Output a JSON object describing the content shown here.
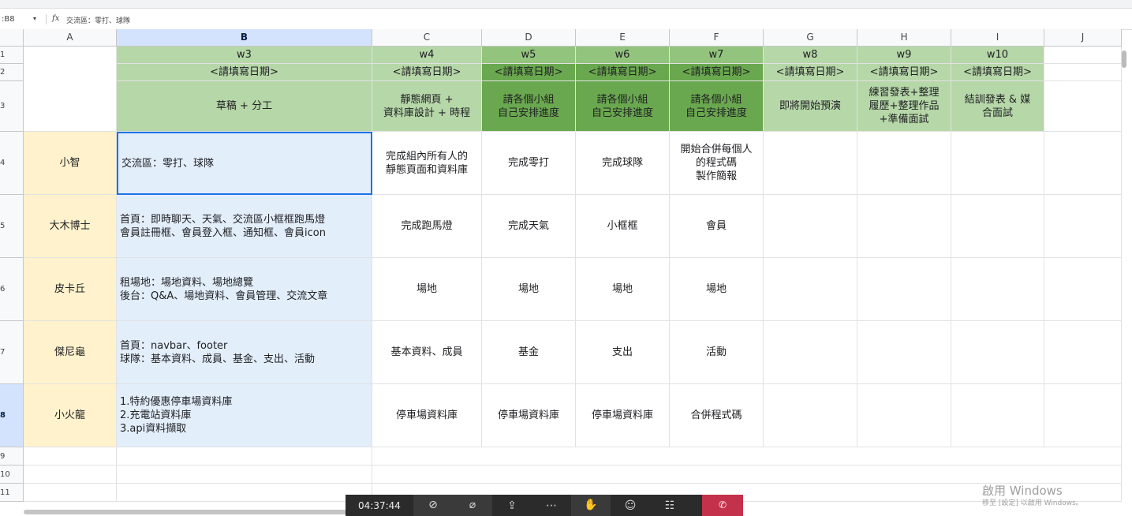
{
  "formula_bar": {
    "cell_ref": ":B8",
    "dropdown": "▾",
    "fx": "fx",
    "content": "交流區：零打、球隊"
  },
  "columns": [
    "A",
    "B",
    "C",
    "D",
    "E",
    "F",
    "G",
    "H",
    "I",
    "J"
  ],
  "rows": [
    "1",
    "2",
    "3",
    "4",
    "5",
    "6",
    "7",
    "8",
    "9",
    "10",
    "11"
  ],
  "sheet": {
    "weeks": [
      "w3",
      "w4",
      "w5",
      "w6",
      "w7",
      "w8",
      "w9",
      "w10"
    ],
    "dates": [
      "<請填寫日期>",
      "<請填寫日期>",
      "<請填寫日期>",
      "<請填寫日期>",
      "<請填寫日期>",
      "<請填寫日期>",
      "<請填寫日期>",
      "<請填寫日期>"
    ],
    "topics": [
      "草稿 + 分工",
      "靜態網頁 +\n資料庫設計 + 時程",
      "請各個小組\n自己安排進度",
      "請各個小組\n自己安排進度",
      "請各個小組\n自己安排進度",
      "即將開始預演",
      "練習發表+整理\n履歷+整理作品\n+準備面試",
      "結訓發表 & 媒\n合面試"
    ],
    "members": [
      {
        "name": "小智",
        "tasks": [
          "交流區：零打、球隊",
          "完成組內所有人的\n靜態頁面和資料庫",
          "完成零打",
          "完成球隊",
          "開始合併每個人\n的程式碼\n製作簡報"
        ]
      },
      {
        "name": "大木博士",
        "tasks": [
          "首頁：即時聊天、天氣、交流區小框框跑馬燈\n會員註冊框、會員登入框、通知框、會員icon",
          "完成跑馬燈",
          "完成天氣",
          "小框框",
          "會員"
        ]
      },
      {
        "name": "皮卡丘",
        "tasks": [
          "租場地：場地資料、場地總覽\n後台：Q&A、場地資料、會員管理、交流文章",
          "場地",
          "場地",
          "場地",
          "場地"
        ]
      },
      {
        "name": "傑尼龜",
        "tasks": [
          "首頁：navbar、footer\n球隊：基本資料、成員、基金、支出、活動",
          "基本資料、成員",
          "基金",
          "支出",
          "活動"
        ]
      },
      {
        "name": "小火龍",
        "tasks": [
          "1.特約優惠停車場資料庫\n2.充電站資料庫\n3.api資料擷取",
          "停車場資料庫",
          "停車場資料庫",
          "停車場資料庫",
          "合併程式碼"
        ]
      }
    ]
  },
  "meeting_bar": {
    "time": "04:37:44",
    "icons": [
      "camera-off-icon",
      "mic-off-icon",
      "share-icon",
      "more-icon",
      "raise-hand-icon",
      "chat-icon",
      "people-icon",
      "leave-icon"
    ]
  },
  "watermark": {
    "line1": "啟用 Windows",
    "line2": "移至 [設定] 以啟用 Windows。"
  },
  "colors": {
    "header_green": "#b6d7a8",
    "mid_green": "#93c47d",
    "dark_green": "#6aa84f",
    "name_bg": "#fff2cc",
    "task_bg": "#e3eefb",
    "selection": "#1a73e8"
  }
}
